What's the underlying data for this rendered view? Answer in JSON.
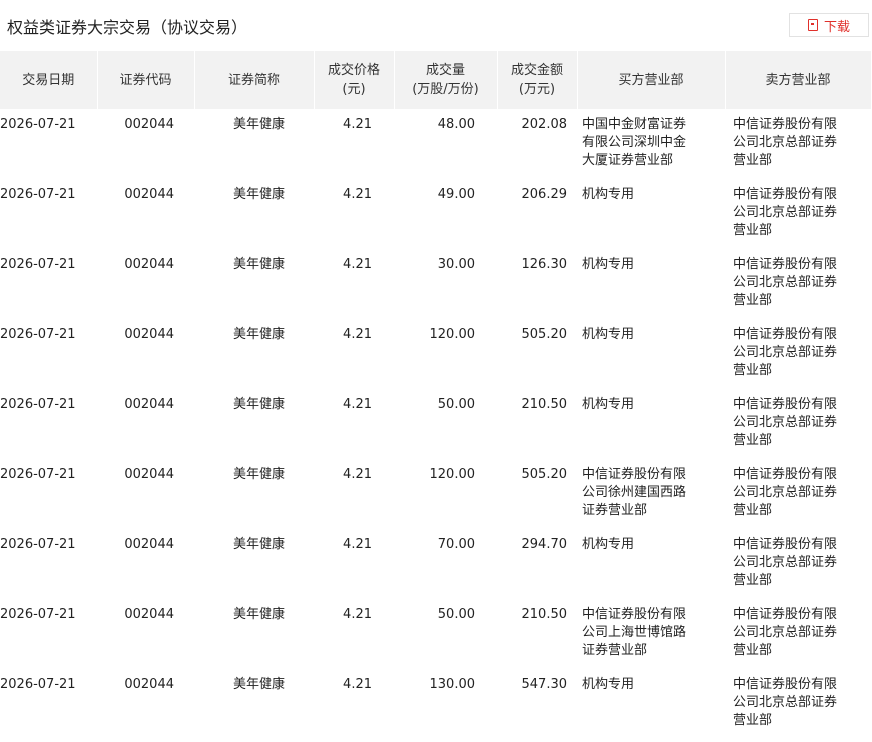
{
  "header": {
    "title": "权益类证券大宗交易（协议交易）",
    "download_label": "下载"
  },
  "table": {
    "columns": [
      {
        "line1": "交易日期",
        "line2": ""
      },
      {
        "line1": "证券代码",
        "line2": ""
      },
      {
        "line1": "证券简称",
        "line2": ""
      },
      {
        "line1": "成交价格",
        "line2": "(元)"
      },
      {
        "line1": "成交量",
        "line2": "(万股/万份)"
      },
      {
        "line1": "成交金额",
        "line2": "(万元)"
      },
      {
        "line1": "买方营业部",
        "line2": ""
      },
      {
        "line1": "卖方营业部",
        "line2": ""
      }
    ],
    "rows": [
      [
        "2026-07-21",
        "002044",
        "美年健康",
        "4.21",
        "48.00",
        "202.08",
        "中国中金财富证券有限公司深圳中金大厦证券营业部",
        "中信证券股份有限公司北京总部证券营业部"
      ],
      [
        "2026-07-21",
        "002044",
        "美年健康",
        "4.21",
        "49.00",
        "206.29",
        "机构专用",
        "中信证券股份有限公司北京总部证券营业部"
      ],
      [
        "2026-07-21",
        "002044",
        "美年健康",
        "4.21",
        "30.00",
        "126.30",
        "机构专用",
        "中信证券股份有限公司北京总部证券营业部"
      ],
      [
        "2026-07-21",
        "002044",
        "美年健康",
        "4.21",
        "120.00",
        "505.20",
        "机构专用",
        "中信证券股份有限公司北京总部证券营业部"
      ],
      [
        "2026-07-21",
        "002044",
        "美年健康",
        "4.21",
        "50.00",
        "210.50",
        "机构专用",
        "中信证券股份有限公司北京总部证券营业部"
      ],
      [
        "2026-07-21",
        "002044",
        "美年健康",
        "4.21",
        "120.00",
        "505.20",
        "中信证券股份有限公司徐州建国西路证券营业部",
        "中信证券股份有限公司北京总部证券营业部"
      ],
      [
        "2026-07-21",
        "002044",
        "美年健康",
        "4.21",
        "70.00",
        "294.70",
        "机构专用",
        "中信证券股份有限公司北京总部证券营业部"
      ],
      [
        "2026-07-21",
        "002044",
        "美年健康",
        "4.21",
        "50.00",
        "210.50",
        "中信证券股份有限公司上海世博馆路证券营业部",
        "中信证券股份有限公司北京总部证券营业部"
      ],
      [
        "2026-07-21",
        "002044",
        "美年健康",
        "4.21",
        "130.00",
        "547.30",
        "机构专用",
        "中信证券股份有限公司北京总部证券营业部"
      ]
    ]
  },
  "colors": {
    "accent": "#e0302b",
    "header_bg": "#f2f2f2"
  }
}
